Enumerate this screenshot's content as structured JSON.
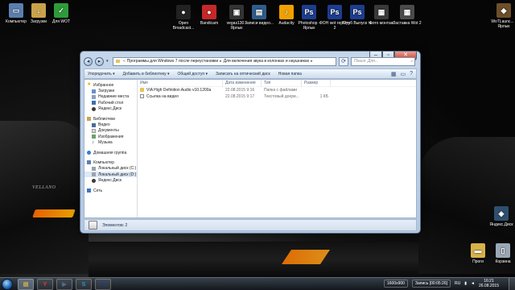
{
  "desktop": {
    "icons": [
      {
        "label": "Компьютер",
        "color": "#5a7fb0",
        "glyph": "▭"
      },
      {
        "label": "Загрузки",
        "color": "#c9a24a",
        "glyph": "↓"
      },
      {
        "label": "Для WOT",
        "color": "#2e9b3a",
        "glyph": "✓"
      },
      {
        "label": "Open Broadcast...",
        "color": "#222222",
        "glyph": "●"
      },
      {
        "label": "Bandicam",
        "color": "#c62828",
        "glyph": "●"
      },
      {
        "label": "vegas130 - Ярлык",
        "color": "#333333",
        "glyph": "▣"
      },
      {
        "label": "Записи видео...",
        "color": "#2f5d8a",
        "glyph": "▤"
      },
      {
        "label": "Audacity",
        "color": "#f0a000",
        "glyph": "♪"
      },
      {
        "label": "Photoshop - Ярлык",
        "color": "#1d3d8f",
        "glyph": "Ps"
      },
      {
        "label": "ФОН wot replays 2",
        "color": "#1d3d8f",
        "glyph": "Ps"
      },
      {
        "label": "Ютуб Выпуск №",
        "color": "#1d3d8f",
        "glyph": "Ps"
      },
      {
        "label": "Фото монтаж",
        "color": "#3a3a3a",
        "glyph": "▦"
      },
      {
        "label": "Заставка Wot 2",
        "color": "#4b4b4b",
        "glyph": "▦"
      },
      {
        "label": "WoTLaunc... - Ярлык",
        "color": "#6d4f2a",
        "glyph": "◆"
      },
      {
        "label": "Яндекс.Диск",
        "color": "#2f4f6f",
        "glyph": "◈"
      },
      {
        "label": "Проги",
        "color": "#d8b24a",
        "glyph": "▬"
      },
      {
        "label": "Корзина",
        "color": "#9aa8b5",
        "glyph": "▯"
      }
    ],
    "wallpaper_text": "VELLANO"
  },
  "window": {
    "address": {
      "crumbs": [
        "Программы для Windows 7 после переустановки",
        "Для включения звука в колонках и наушниках"
      ],
      "search_placeholder": "Поиск: Для..."
    },
    "toolbar": {
      "items": [
        "Упорядочить ▾",
        "Добавить в библиотеку ▾",
        "Общий доступ ▾",
        "Записать на оптический диск",
        "Новая папка"
      ]
    },
    "nav": {
      "favorites": "Избранное",
      "favorites_items": [
        "Загрузки",
        "Недавние места",
        "Рабочий стол",
        "Яндекс.Диск"
      ],
      "libraries": "Библиотеки",
      "libraries_items": [
        "Видео",
        "Документы",
        "Изображения",
        "Музыка"
      ],
      "homegroup": "Домашняя группа",
      "computer": "Компьютер",
      "computer_items": [
        "Локальный диск (C:)",
        "Локальный диск (D:)",
        "Яндекс.Диск"
      ],
      "network": "Сеть"
    },
    "columns": {
      "name": "Имя",
      "date": "Дата изменения",
      "type": "Тип",
      "size": "Размер"
    },
    "files": [
      {
        "name": "VIA High Definition Audio v10.1200a",
        "date": "22.08.2015 9:16",
        "type": "Папка с файлами",
        "size": "",
        "icon": "folder"
      },
      {
        "name": "Ссылка на видео",
        "date": "22.08.2015 9:17",
        "type": "Текстовый докум...",
        "size": "1 КБ",
        "icon": "text"
      }
    ],
    "status": "Элементов: 2"
  },
  "taskbar": {
    "apps": [
      {
        "name": "explorer",
        "glyph": "▤",
        "color": "#d8b24a"
      },
      {
        "name": "yandex",
        "glyph": "Y",
        "color": "#e53935"
      },
      {
        "name": "media",
        "glyph": "▶",
        "color": "#4b6f91"
      },
      {
        "name": "skype",
        "glyph": "S",
        "color": "#1e9bd7"
      },
      {
        "name": "photoshop",
        "glyph": "Ps",
        "color": "#1d3d8f"
      }
    ],
    "tray": {
      "resolution": "1600x900",
      "record": "Запись [00:05:26]",
      "lang": "RU",
      "time": "16:21",
      "date": "26.08.2015"
    }
  }
}
